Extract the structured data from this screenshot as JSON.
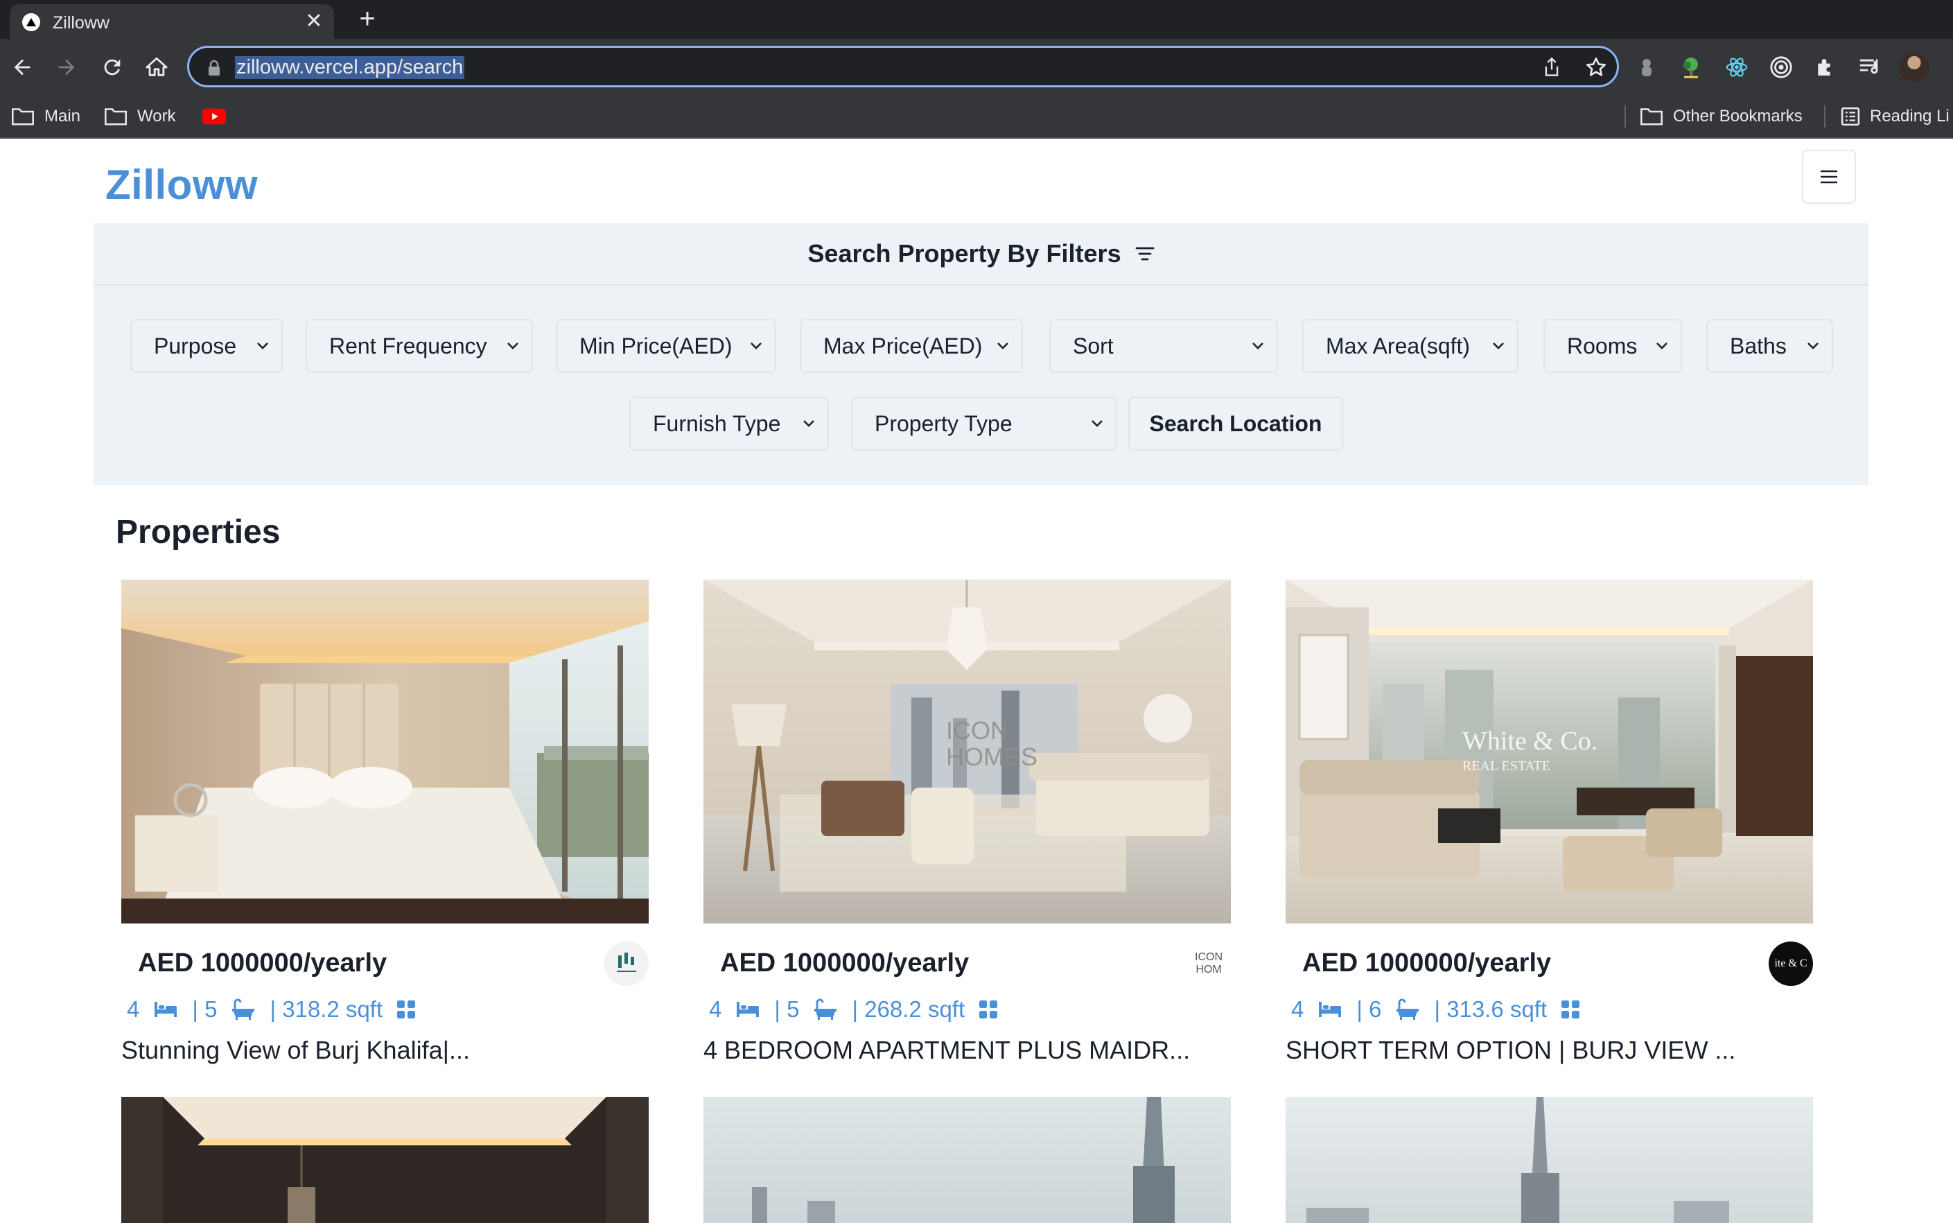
{
  "browser": {
    "tab_title": "Zilloww",
    "tab_close": "✕",
    "new_tab": "+",
    "url": "zilloww.vercel.app/search",
    "bookmarks": {
      "main": "Main",
      "work": "Work",
      "other": "Other Bookmarks",
      "reading": "Reading Li"
    }
  },
  "header": {
    "brand": "Zilloww"
  },
  "filters": {
    "title": "Search Property By Filters",
    "purpose": "Purpose",
    "rent_frequency": "Rent Frequency",
    "min_price": "Min Price(AED)",
    "max_price": "Max Price(AED)",
    "sort": "Sort",
    "max_area": "Max Area(sqft)",
    "rooms": "Rooms",
    "baths": "Baths",
    "furnish_type": "Furnish Type",
    "property_type": "Property Type",
    "search_location": "Search Location"
  },
  "properties": {
    "title": "Properties",
    "items": [
      {
        "price": "AED 1000000/yearly",
        "rooms": "4",
        "baths": "| 5",
        "area": "| 318.2 sqft",
        "title": "Stunning View of Burj Khalifa|..."
      },
      {
        "price": "AED 1000000/yearly",
        "rooms": "4",
        "baths": "| 5",
        "area": "| 268.2 sqft",
        "title": "4 BEDROOM APARTMENT PLUS MAIDR..."
      },
      {
        "price": "AED 1000000/yearly",
        "rooms": "4",
        "baths": "| 6",
        "area": "| 313.6 sqft",
        "title": "SHORT TERM OPTION | BURJ VIEW ..."
      }
    ]
  },
  "image_watermarks": {
    "icon_homes_line1": "ICON",
    "icon_homes_line2": "HOMES",
    "white_co": "White & Co.",
    "white_co_sub": "REAL ESTATE",
    "icon_logo_line1": "ICON",
    "icon_logo_line2": "HOM",
    "white_logo": "ite & C"
  },
  "colors": {
    "brand": "#4a90d9",
    "filter_bg": "#edf2f7",
    "text": "#1a202c",
    "chrome_dark": "#202124",
    "chrome": "#35363a"
  }
}
